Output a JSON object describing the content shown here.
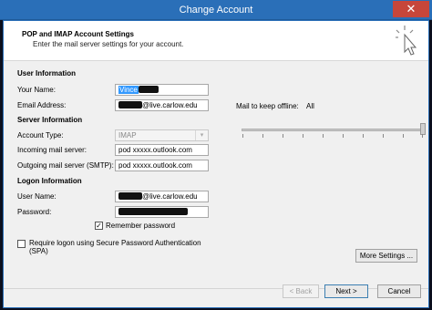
{
  "window": {
    "title": "Change Account",
    "close_glyph": "✕"
  },
  "header": {
    "title": "POP and IMAP Account Settings",
    "subtitle": "Enter the mail server settings for your account.",
    "icon": "cursor-click-icon"
  },
  "user_info": {
    "section_label": "User Information",
    "name_label": "Your Name:",
    "name_value": "Vince",
    "email_label": "Email Address:",
    "email_value": "@live.carlow.edu"
  },
  "server_info": {
    "section_label": "Server Information",
    "account_type_label": "Account Type:",
    "account_type_value": "IMAP",
    "incoming_label": "Incoming mail server:",
    "incoming_value": "pod xxxxx.outlook.com",
    "outgoing_label": "Outgoing mail server (SMTP):",
    "outgoing_value": "pod xxxxx.outlook.com"
  },
  "logon_info": {
    "section_label": "Logon Information",
    "username_label": "User Name:",
    "username_value": "@live.carlow.edu",
    "password_label": "Password:",
    "remember_label": "Remember password",
    "remember_checked": true,
    "spa_label_line1": "Require logon using Secure Password Authentication",
    "spa_label_line2": "(SPA)",
    "spa_checked": false
  },
  "offline": {
    "label": "Mail to keep offline:",
    "value": "All",
    "slider_level_percent": 100
  },
  "buttons": {
    "more_settings": "More Settings ...",
    "back": "< Back",
    "next": "Next >",
    "cancel": "Cancel"
  }
}
